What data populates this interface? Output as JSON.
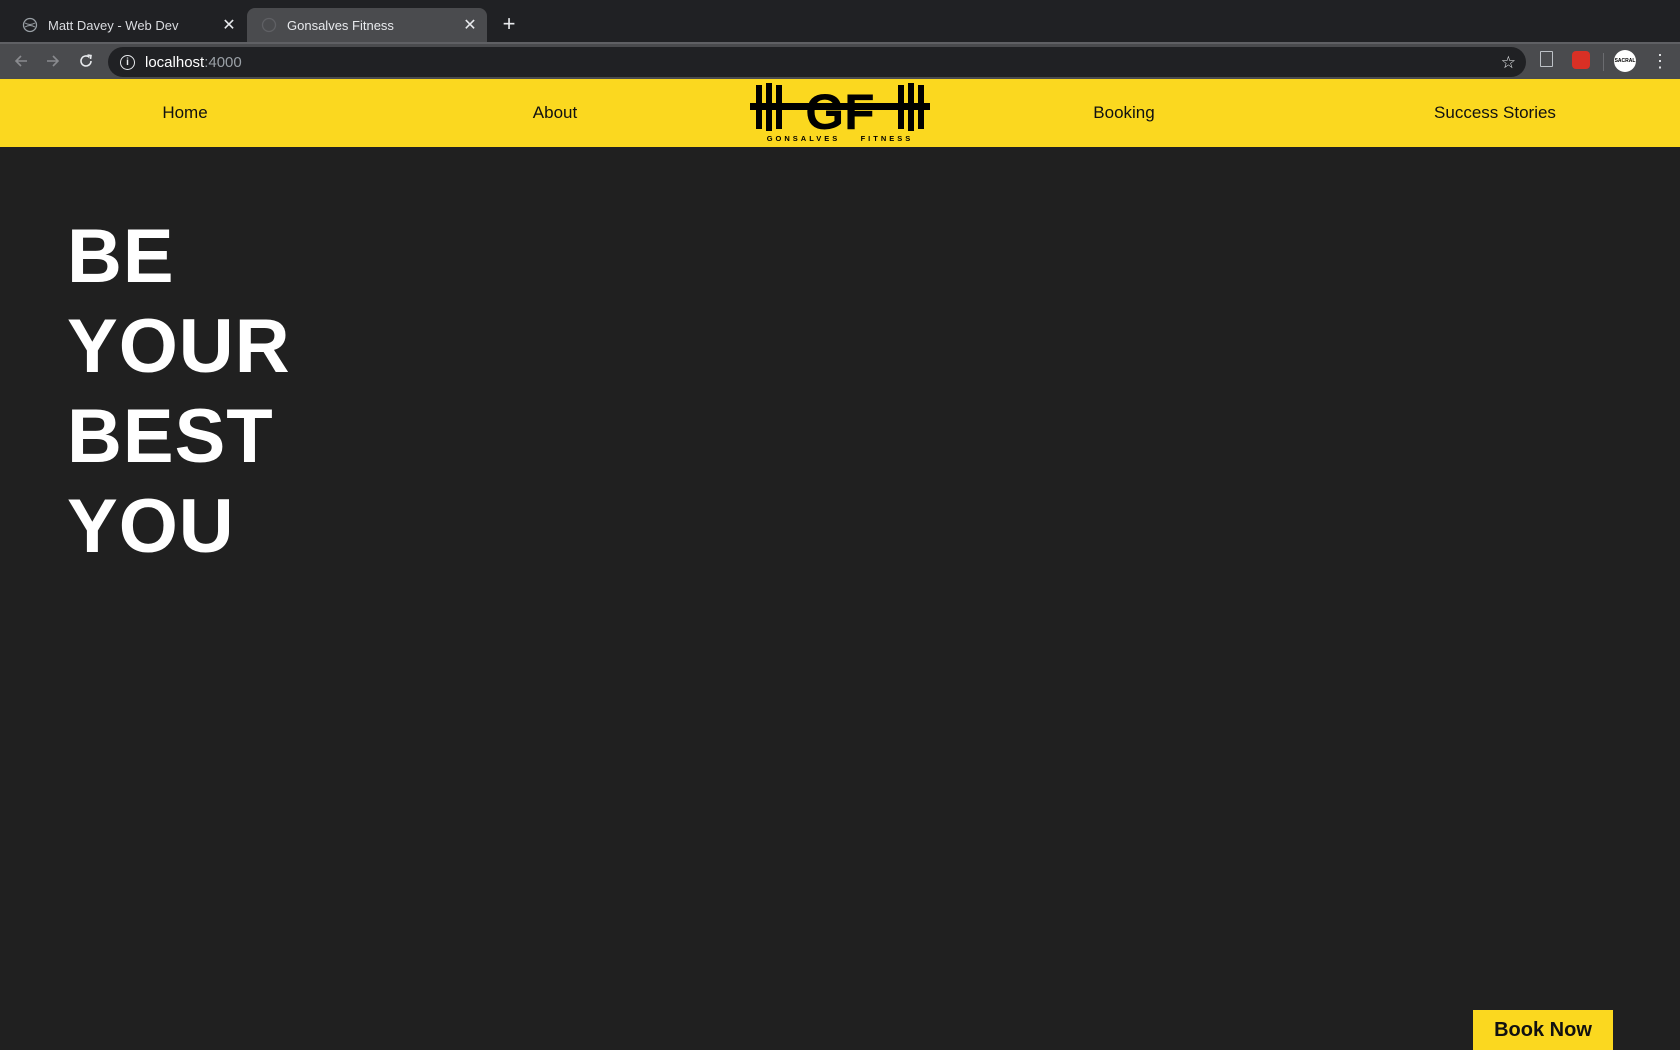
{
  "browser": {
    "tabs": [
      {
        "title": "Matt Davey - Web Dev",
        "active": false,
        "icon": "globe-icon"
      },
      {
        "title": "Gonsalves Fitness",
        "active": true,
        "icon": "globe-icon"
      }
    ],
    "new_tab_icon": "plus-icon",
    "address": {
      "host": "localhost",
      "port": ":4000"
    },
    "profile_label": "SACRAL"
  },
  "site": {
    "nav": {
      "home": "Home",
      "about": "About",
      "booking": "Booking",
      "success": "Success Stories"
    },
    "logo": {
      "monogram": "GF",
      "wordmark": "GONSALVES    FITNESS"
    },
    "hero": {
      "line1": "BE",
      "line2": "YOUR",
      "line3": "BEST",
      "line4": "YOU"
    },
    "cta": "Book Now"
  },
  "colors": {
    "brand_yellow": "#fbd81f",
    "page_bg": "#202020",
    "hero_text": "#ffffff"
  }
}
